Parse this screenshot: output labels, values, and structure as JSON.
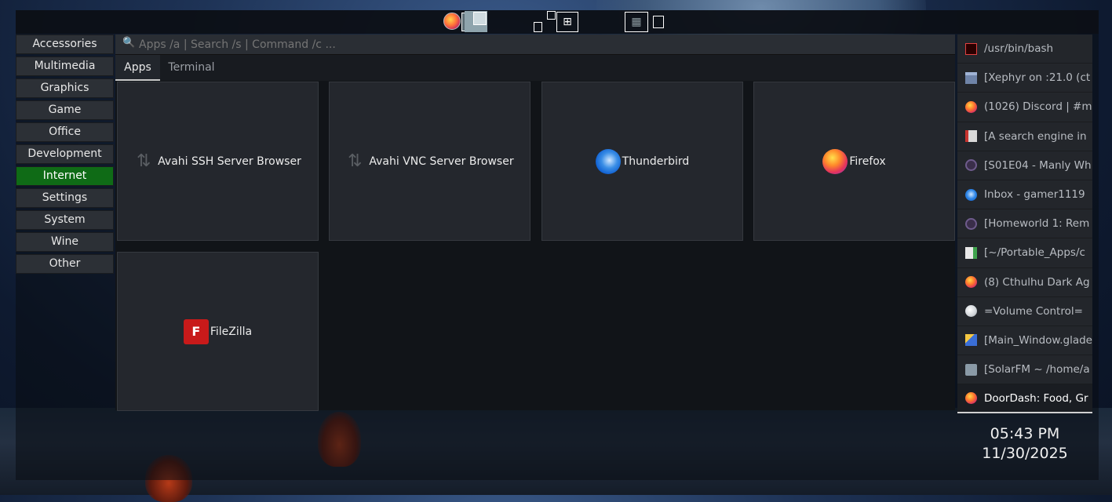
{
  "search": {
    "placeholder": "Apps /a | Search /s | Command /c ..."
  },
  "categories": [
    {
      "label": "Accessories",
      "active": false
    },
    {
      "label": "Multimedia",
      "active": false
    },
    {
      "label": "Graphics",
      "active": false
    },
    {
      "label": "Game",
      "active": false
    },
    {
      "label": "Office",
      "active": false
    },
    {
      "label": "Development",
      "active": false
    },
    {
      "label": "Internet",
      "active": true
    },
    {
      "label": "Settings",
      "active": false
    },
    {
      "label": "System",
      "active": false
    },
    {
      "label": "Wine",
      "active": false
    },
    {
      "label": "Other",
      "active": false
    }
  ],
  "tabs": {
    "apps": "Apps",
    "terminal": "Terminal"
  },
  "apps": [
    {
      "label": "Avahi SSH Server Browser",
      "icon": "avahi-icon"
    },
    {
      "label": "Avahi VNC Server Browser",
      "icon": "avahi-icon"
    },
    {
      "label": "Thunderbird",
      "icon": "thunderbird-icon"
    },
    {
      "label": "Firefox",
      "icon": "firefox-icon"
    },
    {
      "label": "FileZilla",
      "icon": "filezilla-icon"
    }
  ],
  "windows": [
    {
      "label": "/usr/bin/bash",
      "icon": "terminal-icon"
    },
    {
      "label": "[Xephyr on :21.0 (ct",
      "icon": "xephyr-icon"
    },
    {
      "label": "(1026) Discord | #m",
      "icon": "firefox-icon"
    },
    {
      "label": "[A search engine in",
      "icon": "document-icon"
    },
    {
      "label": "[S01E04 - Manly Wh",
      "icon": "media-player-icon"
    },
    {
      "label": "Inbox - gamer1119",
      "icon": "thunderbird-icon"
    },
    {
      "label": "[Homeworld 1: Rem",
      "icon": "media-player-icon"
    },
    {
      "label": "[~/Portable_Apps/c",
      "icon": "text-editor-icon"
    },
    {
      "label": "(8) Cthulhu Dark Ag",
      "icon": "firefox-icon"
    },
    {
      "label": "=Volume Control=",
      "icon": "volume-icon"
    },
    {
      "label": "[Main_Window.glade]",
      "icon": "glade-icon"
    },
    {
      "label": "[SolarFM ~ /home/a",
      "icon": "file-manager-icon"
    },
    {
      "label": "DoorDash: Food, Gr",
      "icon": "firefox-icon",
      "focused": true
    }
  ],
  "clock": {
    "time": "05:43 PM",
    "date": "11/30/2025"
  },
  "icons": {
    "search": "🔍",
    "plus": "⊞",
    "grid": "▦",
    "avahi": "⇅"
  },
  "colors": {
    "active_category": "#0f6b16",
    "panel_bg": "#24272d"
  }
}
